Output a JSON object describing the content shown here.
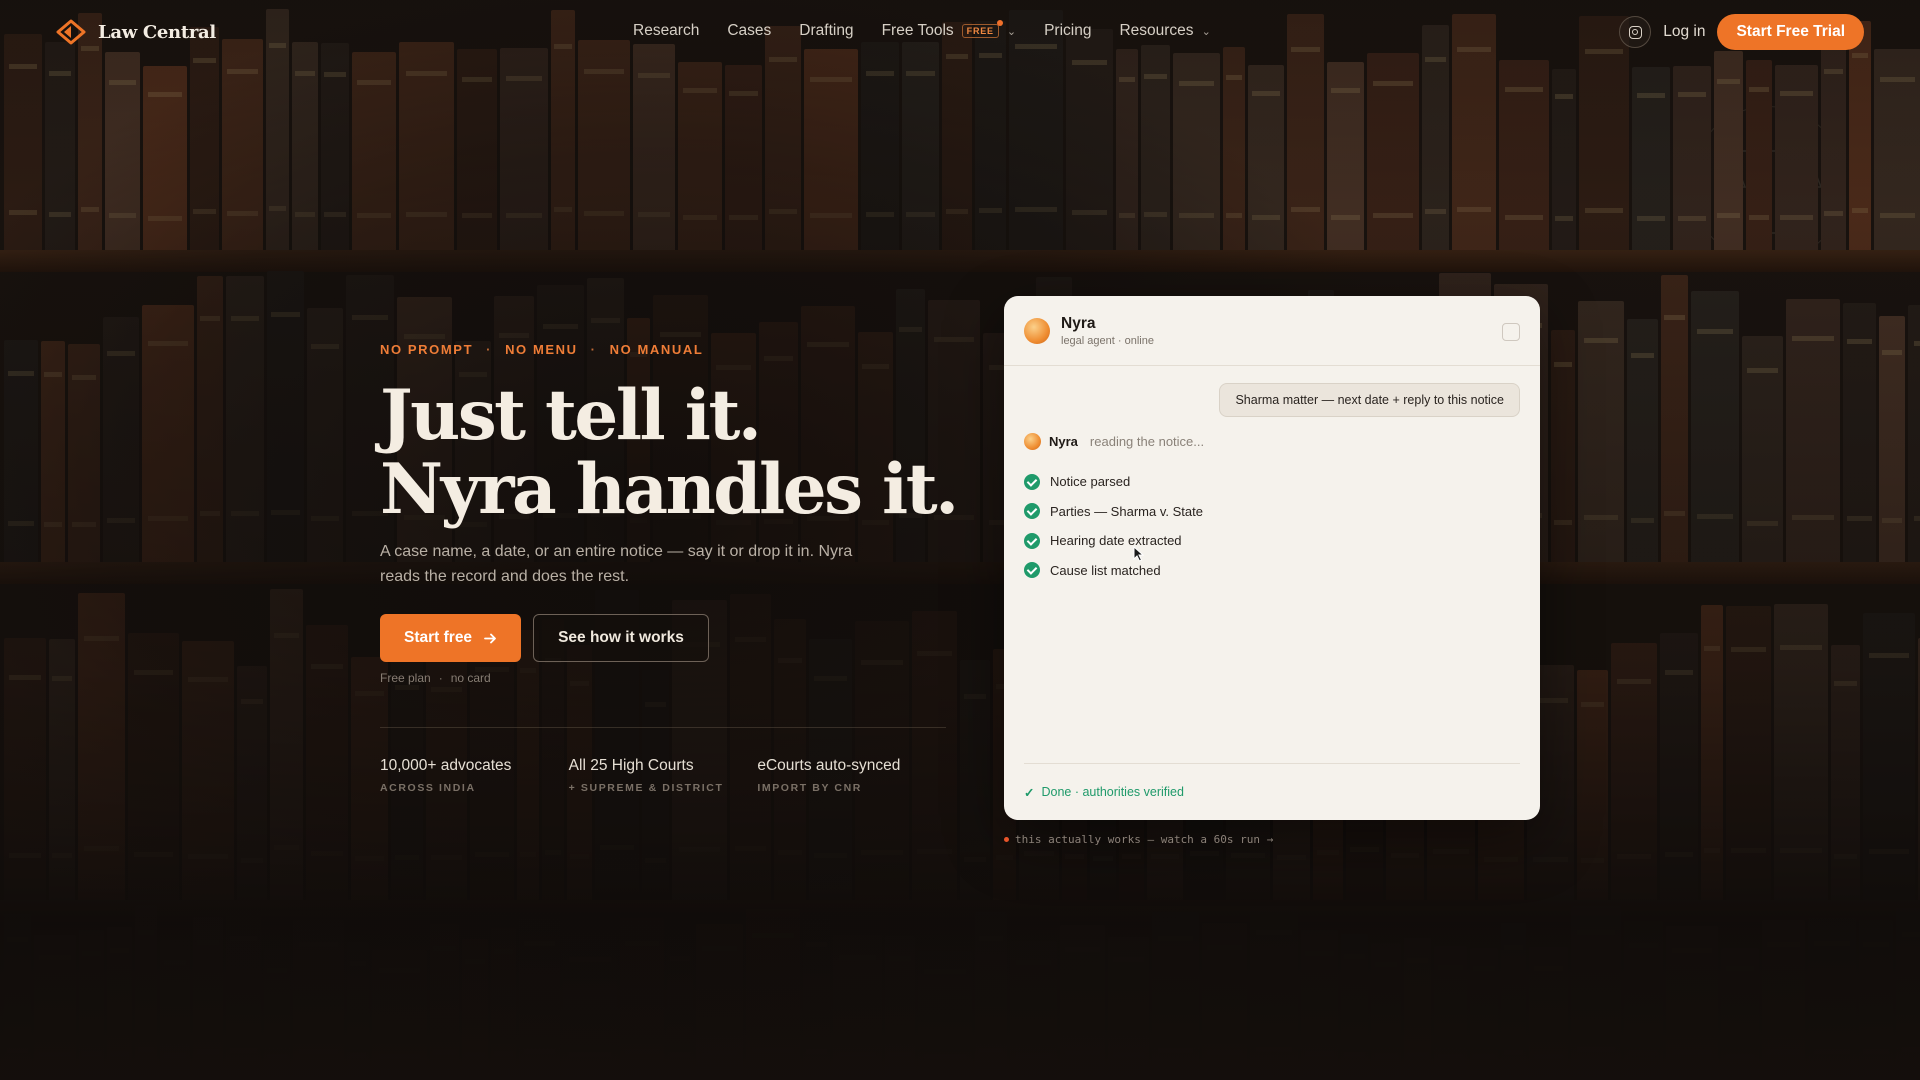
{
  "nav": {
    "brand": "Law Central",
    "items": [
      {
        "label": "Research"
      },
      {
        "label": "Cases"
      },
      {
        "label": "Drafting"
      },
      {
        "label": "Free Tools",
        "badge": "FREE",
        "has_dropdown": true
      },
      {
        "label": "Pricing"
      },
      {
        "label": "Resources",
        "has_dropdown": true
      }
    ],
    "social_icon": "instagram-icon",
    "login": "Log in",
    "cta": "Start Free Trial"
  },
  "hero": {
    "eyebrow": [
      "NO PROMPT",
      "NO MENU",
      "NO MANUAL"
    ],
    "eyebrow_sep": "·",
    "headline_line1": "Just tell it.",
    "headline_line2": "Nyra handles it.",
    "subtext": "A case name, a date, or an entire notice — say it or drop it in. Nyra reads the record and does the rest.",
    "primary_cta": "Start free",
    "primary_cta_icon": "arrow-right-icon",
    "secondary_cta": "See how it works",
    "note_part1": "Free plan",
    "note_sep": "·",
    "note_part2": "no card",
    "stats": [
      {
        "value": "10,000+ advocates",
        "label": "ACROSS INDIA"
      },
      {
        "value": "All 25 High Courts",
        "label": "+ SUPREME & DISTRICT"
      },
      {
        "value": "eCourts auto-synced",
        "label": "IMPORT BY CNR"
      }
    ]
  },
  "chat": {
    "agent_name": "Nyra",
    "agent_status": "legal agent · online",
    "user_message": "Sharma matter — next date + reply to this notice",
    "reading_name": "Nyra",
    "reading_status": "reading the notice...",
    "steps": [
      "Notice parsed",
      "Parties — Sharma v. State",
      "Hearing date extracted",
      "Cause list matched"
    ],
    "footer_status": "Done · authorities verified",
    "below_text": "this actually works — watch a 60s run →"
  },
  "colors": {
    "accent": "#ee7427",
    "success": "#1f9a6a",
    "card_bg": "#f5f2ec",
    "page_bg": "#1c1510"
  }
}
